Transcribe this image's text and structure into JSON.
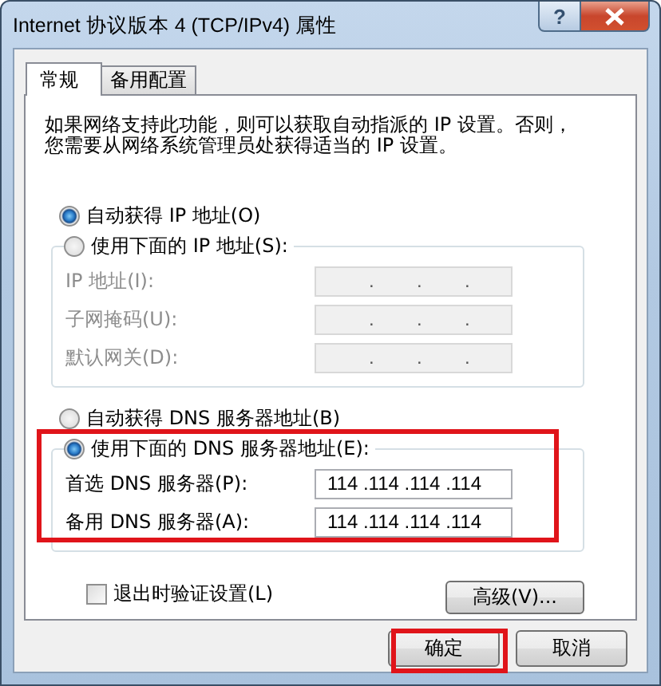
{
  "window": {
    "title": "Internet 协议版本 4 (TCP/IPv4) 属性",
    "help_button": "?"
  },
  "tabs": [
    {
      "label": "常规",
      "selected": true
    },
    {
      "label": "备用配置",
      "selected": false
    }
  ],
  "description": "如果网络支持此功能，则可以获取自动指派的 IP 设置。否则，您需要从网络系统管理员处获得适当的 IP 设置。",
  "ip_mode": [
    {
      "label": "自动获得 IP 地址(O)",
      "selected": true
    },
    {
      "label": "使用下面的 IP 地址(S):",
      "selected": false
    }
  ],
  "ip_fields": [
    {
      "label": "IP 地址(I):",
      "value": ".        .        .",
      "disabled": true
    },
    {
      "label": "子网掩码(U):",
      "value": ".        .        .",
      "disabled": true
    },
    {
      "label": "默认网关(D):",
      "value": ".        .        .",
      "disabled": true
    }
  ],
  "dns_mode": [
    {
      "label": "自动获得 DNS 服务器地址(B)",
      "selected": false
    },
    {
      "label": "使用下面的 DNS 服务器地址(E):",
      "selected": true
    }
  ],
  "dns_fields": [
    {
      "label": "首选 DNS 服务器(P):",
      "value": "114 .114 .114 .114",
      "disabled": false
    },
    {
      "label": "备用 DNS 服务器(A):",
      "value": "114 .114 .114 .114",
      "disabled": false
    }
  ],
  "validate_on_exit": {
    "label": "退出时验证设置(L)",
    "checked": false
  },
  "advanced_button": "高级(V)...",
  "buttons": [
    "确定",
    "取消"
  ]
}
